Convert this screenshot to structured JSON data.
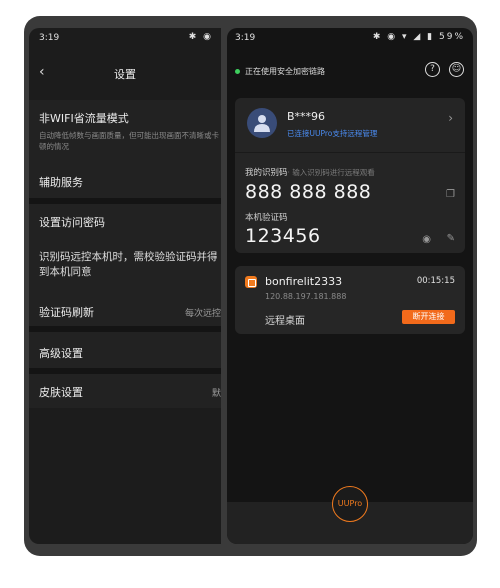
{
  "left_panel": {
    "status": {
      "time": "3:19",
      "icons": "✱ ◉"
    },
    "nav": {
      "back": "‹",
      "title": "设置"
    },
    "items": [
      {
        "title": "非WIFI省流量模式",
        "subtitle": "自动降低帧数与画面质量，但可能出现画面不清晰或卡顿的情况"
      },
      {
        "title": "辅助服务"
      },
      {
        "title": "设置访问密码"
      },
      {
        "description": "识别码远控本机时，需校验验证码并得到本机同意"
      },
      {
        "title": "验证码刷新",
        "value": "每次远控"
      },
      {
        "title": "高级设置"
      },
      {
        "title": "皮肤设置",
        "value": "默"
      }
    ]
  },
  "right_panel": {
    "status": {
      "time": "3:19",
      "icons": "✱ ◉ ▾ ◢ ▮ 59%"
    },
    "secure_text": "正在使用安全加密链路",
    "header_icons": [
      "help-icon",
      "headset-icon"
    ],
    "account": {
      "name": "B***96",
      "sub": "已连接UUPro支持远程管理",
      "chevron": "›"
    },
    "id_label": "我的识别码",
    "id_hint": "· 输入识别码进行远程观看",
    "id_value": "888 888 888",
    "code_label": "本机验证码",
    "code_value": "123456",
    "session": {
      "name": "bonfirelit2333",
      "time": "00:15:15",
      "ip": "120.88.197.181.888",
      "type": "远程桌面",
      "action": "断开连接"
    },
    "fab_label": "UUPro",
    "colors": {
      "accent": "#f26a1b",
      "link": "#4a8bf0",
      "online": "#3ecf5e"
    }
  }
}
